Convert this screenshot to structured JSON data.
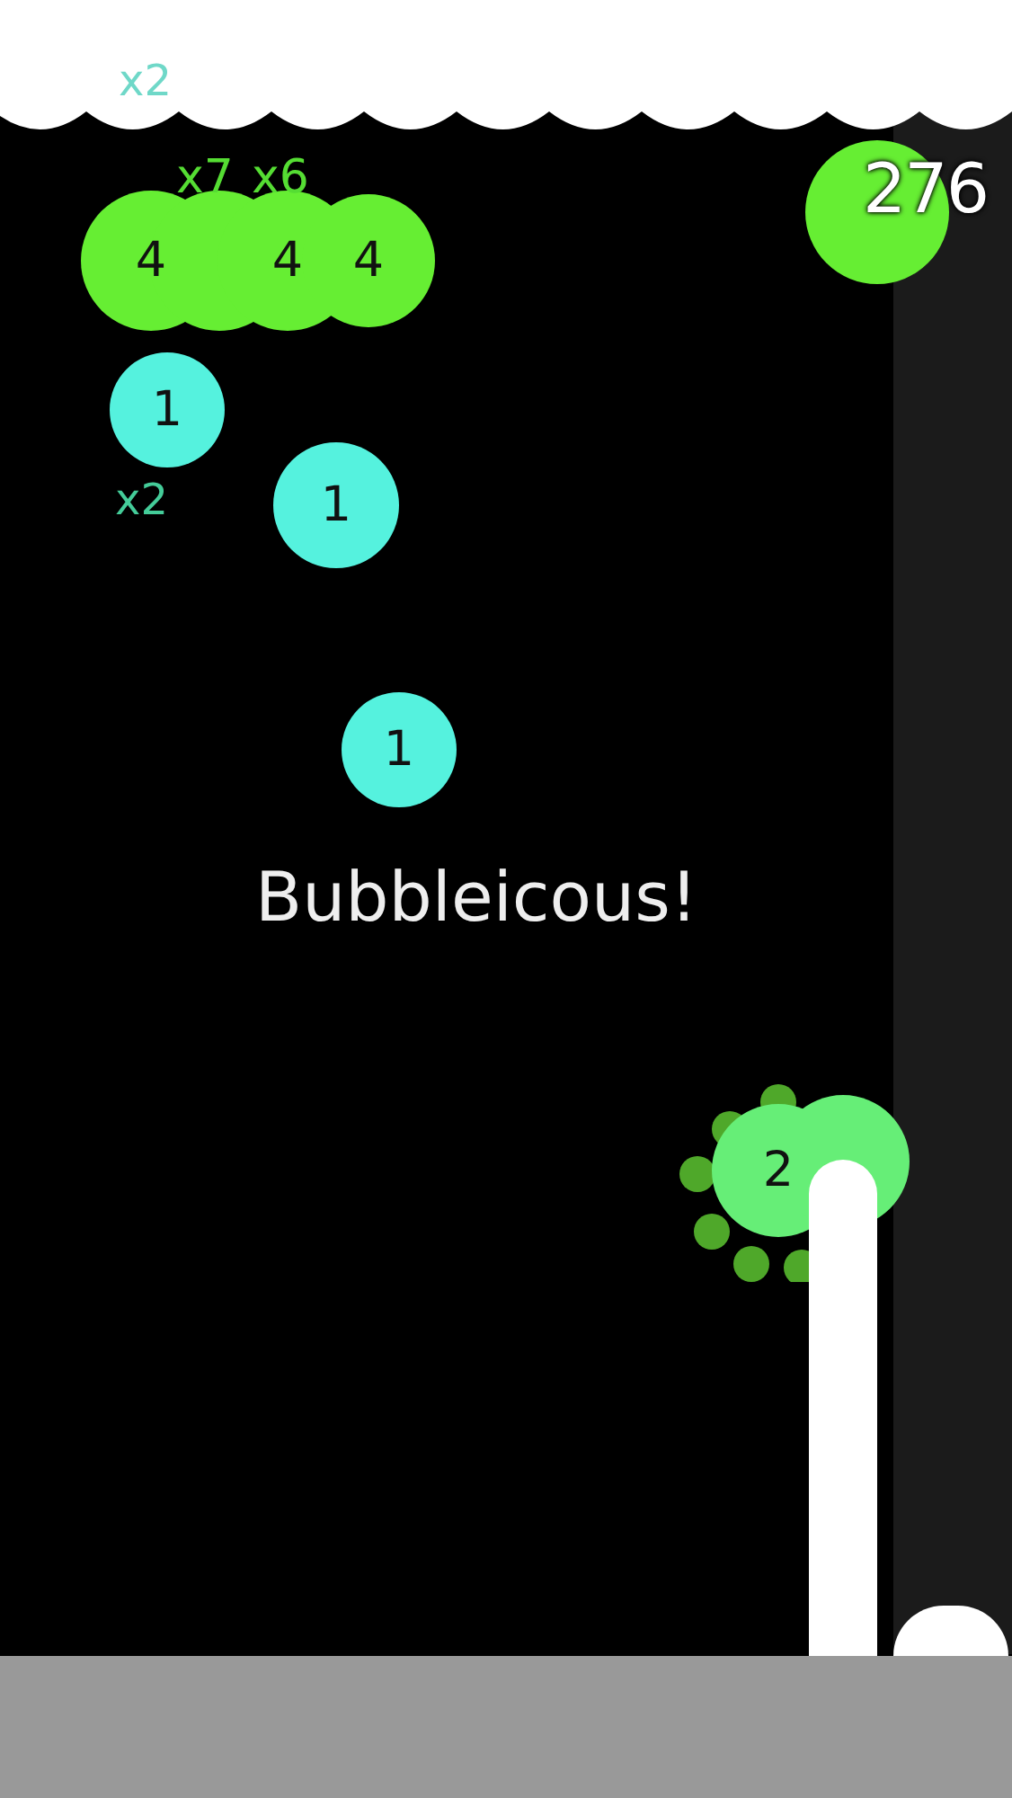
{
  "top_combo": "x2",
  "combo_labels": [
    "x7",
    "x6"
  ],
  "score": "276",
  "bubbles": [
    {
      "kind": "lime",
      "label": "4"
    },
    {
      "kind": "lime"
    },
    {
      "kind": "lime",
      "label": "4"
    },
    {
      "kind": "lime",
      "label": "4"
    },
    {
      "kind": "lime"
    },
    {
      "kind": "aqua",
      "label": "1"
    },
    {
      "kind": "aqua",
      "label": "1"
    },
    {
      "kind": "aqua",
      "label": "1"
    },
    {
      "kind": "mint",
      "label": "2"
    },
    {
      "kind": "mint"
    }
  ],
  "side_combo": "x2",
  "message": "Bubbleicous!"
}
